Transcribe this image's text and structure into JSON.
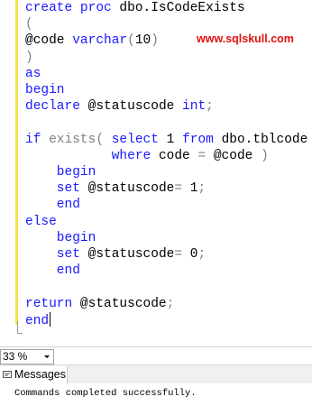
{
  "editor": {
    "lines": [
      {
        "parts": [
          {
            "t": "create proc ",
            "c": "kw"
          },
          {
            "t": "dbo.IsCodeExists",
            "c": "st"
          }
        ]
      },
      {
        "parts": [
          {
            "t": "(",
            "c": "gr"
          }
        ]
      },
      {
        "parts": [
          {
            "t": "@code ",
            "c": "st"
          },
          {
            "t": "varchar",
            "c": "kw"
          },
          {
            "t": "(",
            "c": "gr"
          },
          {
            "t": "10",
            "c": "st"
          },
          {
            "t": ")",
            "c": "gr"
          }
        ]
      },
      {
        "parts": [
          {
            "t": ")",
            "c": "gr"
          }
        ]
      },
      {
        "parts": [
          {
            "t": "as",
            "c": "kw"
          }
        ]
      },
      {
        "parts": [
          {
            "t": "begin",
            "c": "kw"
          }
        ]
      },
      {
        "parts": [
          {
            "t": "declare ",
            "c": "kw"
          },
          {
            "t": "@statuscode ",
            "c": "st"
          },
          {
            "t": "int",
            "c": "kw"
          },
          {
            "t": ";",
            "c": "gr"
          }
        ]
      },
      {
        "parts": [
          {
            "t": "",
            "c": "st"
          }
        ]
      },
      {
        "parts": [
          {
            "t": "if ",
            "c": "kw"
          },
          {
            "t": "exists",
            "c": "gr"
          },
          {
            "t": "( ",
            "c": "gr"
          },
          {
            "t": "select ",
            "c": "kw"
          },
          {
            "t": "1 ",
            "c": "st"
          },
          {
            "t": "from ",
            "c": "kw"
          },
          {
            "t": "dbo.tblcode",
            "c": "st"
          }
        ]
      },
      {
        "parts": [
          {
            "t": "           where ",
            "c": "kw"
          },
          {
            "t": "code ",
            "c": "st"
          },
          {
            "t": "= ",
            "c": "gr"
          },
          {
            "t": "@code ",
            "c": "st"
          },
          {
            "t": ")",
            "c": "gr"
          }
        ]
      },
      {
        "parts": [
          {
            "t": "    begin",
            "c": "kw"
          }
        ]
      },
      {
        "parts": [
          {
            "t": "    set ",
            "c": "kw"
          },
          {
            "t": "@statuscode",
            "c": "st"
          },
          {
            "t": "= ",
            "c": "gr"
          },
          {
            "t": "1",
            "c": "st"
          },
          {
            "t": ";",
            "c": "gr"
          }
        ]
      },
      {
        "parts": [
          {
            "t": "    end",
            "c": "kw"
          }
        ]
      },
      {
        "parts": [
          {
            "t": "else",
            "c": "kw"
          }
        ]
      },
      {
        "parts": [
          {
            "t": "    begin",
            "c": "kw"
          }
        ]
      },
      {
        "parts": [
          {
            "t": "    set ",
            "c": "kw"
          },
          {
            "t": "@statuscode",
            "c": "st"
          },
          {
            "t": "= ",
            "c": "gr"
          },
          {
            "t": "0",
            "c": "st"
          },
          {
            "t": ";",
            "c": "gr"
          }
        ]
      },
      {
        "parts": [
          {
            "t": "    end",
            "c": "kw"
          }
        ]
      },
      {
        "parts": [
          {
            "t": "",
            "c": "st"
          }
        ]
      },
      {
        "parts": [
          {
            "t": "return ",
            "c": "kw"
          },
          {
            "t": "@statuscode",
            "c": "st"
          },
          {
            "t": ";",
            "c": "gr"
          }
        ]
      },
      {
        "parts": [
          {
            "t": "end",
            "c": "kw"
          }
        ],
        "caret": true
      }
    ],
    "watermark": "www.sqlskull.com"
  },
  "statusbar": {
    "zoom": "33 %"
  },
  "results": {
    "tab_label": "Messages",
    "message": "Commands completed successfully."
  },
  "colors": {
    "keyword": "#1a1aff",
    "operator": "#808080",
    "watermark": "#e01010",
    "change_bar": "#f5e24b"
  },
  "icons": {
    "messages_tab": "messages-icon",
    "zoom_dropdown": "chevron-down-icon"
  }
}
